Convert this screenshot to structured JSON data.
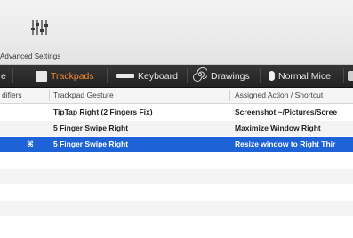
{
  "toolbar": {
    "advanced_settings_label": "Advanced Settings",
    "advanced_icon": "sliders-icon"
  },
  "tabs": [
    {
      "label": "e",
      "icon": "",
      "active": false
    },
    {
      "label": "Trackpads",
      "icon": "trackpad-icon",
      "active": true
    },
    {
      "label": "Keyboard",
      "icon": "keyboard-icon",
      "active": false
    },
    {
      "label": "Drawings",
      "icon": "drawing-spiral-icon",
      "active": false
    },
    {
      "label": "Normal Mice",
      "icon": "mouse-icon",
      "active": false
    }
  ],
  "table": {
    "columns": [
      "difiers",
      "Trackpad Gesture",
      "Assigned Action / Shortcut"
    ],
    "rows": [
      {
        "modifier": "",
        "gesture": "TipTap Right (2 Fingers Fix)",
        "action": "Screenshot ~/Pictures/Scree",
        "selected": false
      },
      {
        "modifier": "",
        "gesture": "5 Finger Swipe Right",
        "action": "Maximize Window Right",
        "selected": false
      },
      {
        "modifier": "⌘",
        "gesture": "5 Finger Swipe Right",
        "action": "Resize window to Right Thir",
        "selected": true
      }
    ]
  },
  "colors": {
    "accent_tab": "#f0882e",
    "selection": "#1d62d6",
    "tabbar_bg": "#2b2b2b"
  }
}
